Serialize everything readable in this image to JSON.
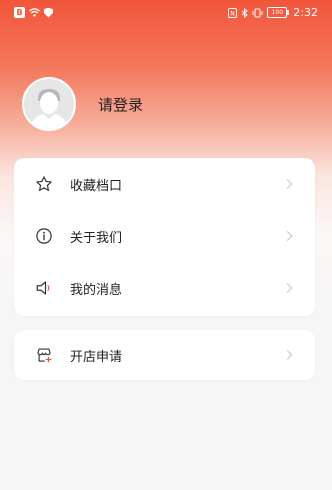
{
  "status_bar": {
    "left_badge": "B",
    "battery": "100",
    "time": "2:32"
  },
  "profile": {
    "login_label": "请登录"
  },
  "menu": {
    "items": [
      {
        "label": "收藏档口",
        "icon": "star-icon"
      },
      {
        "label": "关于我们",
        "icon": "info-icon"
      },
      {
        "label": "我的消息",
        "icon": "speaker-icon"
      }
    ]
  },
  "shop": {
    "label": "开店申请",
    "icon": "shop-add-icon"
  },
  "colors": {
    "accent": "#f2553a",
    "card": "#ffffff",
    "text": "#222222"
  }
}
